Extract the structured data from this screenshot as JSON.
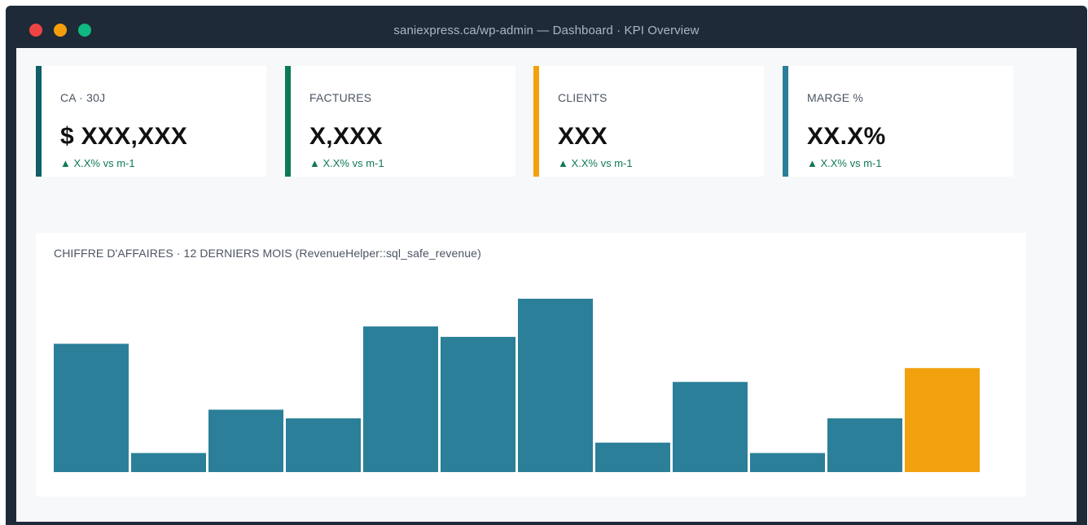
{
  "window": {
    "title": "saniexpress.ca/wp-admin — Dashboard · KPI Overview"
  },
  "colors": {
    "kpi_accents": [
      "#0f5f66",
      "#0c7a55",
      "#f2a10e",
      "#2b7f98"
    ],
    "bar": "#2b7f98",
    "bar_highlight": "#f2a10e",
    "delta": "#0f7a52"
  },
  "kpis": [
    {
      "label": "CA · 30J",
      "value": "$ XXX,XXX",
      "delta": "▲ X.X% vs m-1"
    },
    {
      "label": "FACTURES",
      "value": "X,XXX",
      "delta": "▲ X.X% vs m-1"
    },
    {
      "label": "CLIENTS",
      "value": "XXX",
      "delta": "▲ X.X% vs m-1"
    },
    {
      "label": "MARGE %",
      "value": "XX.X%",
      "delta": "▲ X.X% vs m-1"
    }
  ],
  "chart": {
    "title": "CHIFFRE D'AFFAIRES · 12 DERNIERS MOIS (RevenueHelper::sql_safe_revenue)"
  },
  "chart_data": {
    "type": "bar",
    "categories": [
      "",
      "",
      "",
      "",
      "",
      "",
      "",
      "",
      "",
      "",
      "",
      ""
    ],
    "values": [
      74,
      11,
      36,
      31,
      84,
      78,
      100,
      17,
      52,
      11,
      31,
      60
    ],
    "highlight_index": 11,
    "title": "CHIFFRE D'AFFAIRES · 12 DERNIERS MOIS (RevenueHelper::sql_safe_revenue)",
    "xlabel": "",
    "ylabel": "",
    "ylim": [
      0,
      100
    ],
    "grid": false,
    "legend": "none"
  }
}
